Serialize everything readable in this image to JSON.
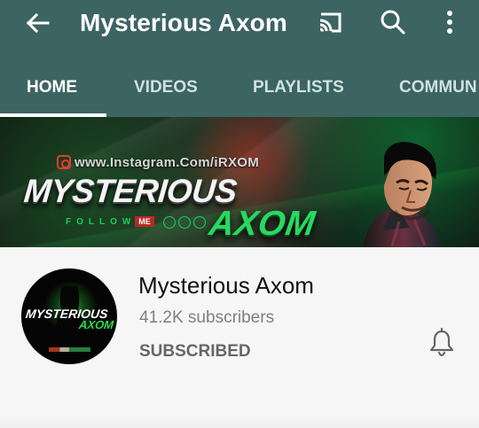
{
  "colors": {
    "app_bar": "#3c6462",
    "tab_active": "#ffffff",
    "tab_inactive": "#cfe2e0",
    "content_background": "#f6f6f6",
    "primary_text": "#121212",
    "secondary_text": "#7f7f7f",
    "subscribed_text": "#666666",
    "banner_green": "#27d960",
    "banner_red": "#ba2926"
  },
  "toolbar": {
    "back_icon": "arrow-left-icon",
    "title": "Mysterious Axom",
    "cast_icon": "cast-icon",
    "search_icon": "search-icon",
    "more_icon": "more-vertical-icon"
  },
  "tabs": [
    {
      "label": "HOME",
      "active": true
    },
    {
      "label": "VIDEOS",
      "active": false
    },
    {
      "label": "PLAYLISTS",
      "active": false
    },
    {
      "label": "COMMUN",
      "active": false
    }
  ],
  "banner": {
    "instagram_icon": "instagram-icon",
    "url": "www.Instagram.Com/iRXOM",
    "headline": "MYSTERIOUS",
    "follow": "FOLLOW",
    "me": "ME",
    "name": "AXOM"
  },
  "channel": {
    "avatar_line_1": "MYSTERIOUS",
    "avatar_line_2": "AXOM",
    "name": "Mysterious Axom",
    "subscribers": "41.2K subscribers",
    "subscription_status": "SUBSCRIBED",
    "bell_icon": "bell-icon"
  }
}
